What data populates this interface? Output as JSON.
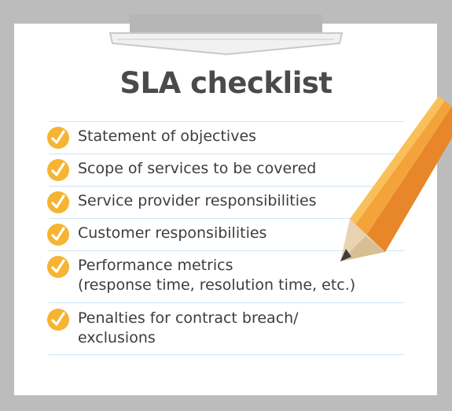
{
  "title": "SLA checklist",
  "colors": {
    "background": "#bdbcbc",
    "paper": "#ffffff",
    "check": "#f5b431",
    "rule": "#cfe6f2",
    "pencil": "#f3a33a",
    "text": "#3d3d3d"
  },
  "items": [
    {
      "icon": "check-icon",
      "lines": [
        "Statement of objectives"
      ]
    },
    {
      "icon": "check-icon",
      "lines": [
        "Scope of services to be covered"
      ]
    },
    {
      "icon": "check-icon",
      "lines": [
        "Service provider responsibilities"
      ]
    },
    {
      "icon": "check-icon",
      "lines": [
        "Customer responsibilities"
      ]
    },
    {
      "icon": "check-icon",
      "lines": [
        "Performance metrics",
        "(response time, resolution time, etc.)"
      ]
    },
    {
      "icon": "check-icon",
      "lines": [
        "Penalties for contract breach/",
        "exclusions"
      ]
    }
  ]
}
